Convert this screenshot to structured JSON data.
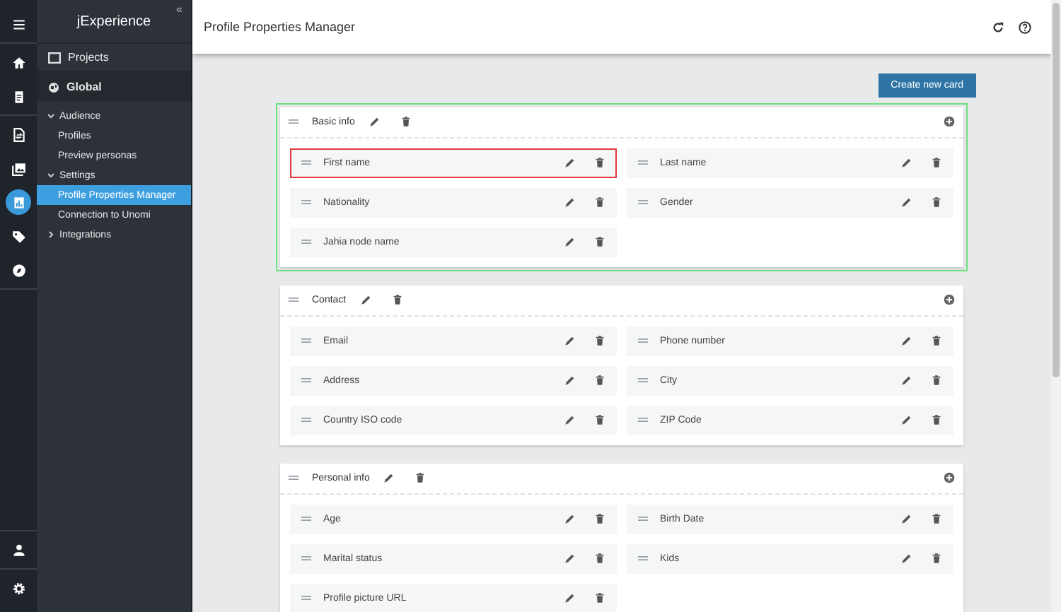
{
  "rail": {
    "top_groups": [
      [
        {
          "kind": "menu",
          "selected": false
        }
      ],
      [
        {
          "kind": "home",
          "selected": false
        },
        {
          "kind": "clipboard",
          "selected": false
        }
      ],
      [
        {
          "kind": "document",
          "selected": false
        },
        {
          "kind": "images",
          "selected": false
        },
        {
          "kind": "chart",
          "selected": true
        },
        {
          "kind": "tag",
          "selected": false
        },
        {
          "kind": "compass",
          "selected": false
        }
      ]
    ],
    "bottom_groups": [
      [
        {
          "kind": "person",
          "selected": false
        }
      ],
      [
        {
          "kind": "gear",
          "selected": false
        }
      ]
    ]
  },
  "nav": {
    "logo": "jExperience",
    "collapse": "«",
    "projects": "Projects",
    "site": "Global",
    "tree": [
      {
        "label": "Audience",
        "expanded": true,
        "children": [
          {
            "label": "Profiles",
            "selected": false
          },
          {
            "label": "Preview personas",
            "selected": false
          }
        ]
      },
      {
        "label": "Settings",
        "expanded": true,
        "children": [
          {
            "label": "Profile Properties Manager",
            "selected": true
          },
          {
            "label": "Connection to Unomi",
            "selected": false
          }
        ]
      },
      {
        "label": "Integrations",
        "expanded": false
      }
    ]
  },
  "header": {
    "title": "Profile Properties Manager"
  },
  "create_button": "Create new card",
  "cards": [
    {
      "title": "Basic info",
      "selected": true,
      "fields": [
        {
          "label": "First name",
          "selected": true
        },
        {
          "label": "Last name",
          "selected": false
        },
        {
          "label": "Nationality",
          "selected": false
        },
        {
          "label": "Gender",
          "selected": false
        },
        {
          "label": "Jahia node name",
          "selected": false
        }
      ]
    },
    {
      "title": "Contact",
      "selected": false,
      "fields": [
        {
          "label": "Email",
          "selected": false
        },
        {
          "label": "Phone number",
          "selected": false
        },
        {
          "label": "Address",
          "selected": false
        },
        {
          "label": "City",
          "selected": false
        },
        {
          "label": "Country ISO code",
          "selected": false
        },
        {
          "label": "ZIP Code",
          "selected": false
        }
      ]
    },
    {
      "title": "Personal info",
      "selected": false,
      "fields": [
        {
          "label": "Age",
          "selected": false
        },
        {
          "label": "Birth Date",
          "selected": false
        },
        {
          "label": "Marital status",
          "selected": false
        },
        {
          "label": "Kids",
          "selected": false
        },
        {
          "label": "Profile picture URL",
          "selected": false
        }
      ]
    }
  ]
}
